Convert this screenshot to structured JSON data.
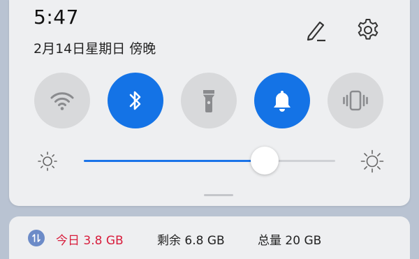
{
  "status": {
    "time": "5:47",
    "date": "2月14日星期日 傍晚"
  },
  "header_icons": [
    "edit-icon",
    "gear-icon"
  ],
  "toggles": [
    {
      "id": "wifi",
      "icon": "wifi-icon",
      "state": "off"
    },
    {
      "id": "bluetooth",
      "icon": "bluetooth-icon",
      "state": "on"
    },
    {
      "id": "flashlight",
      "icon": "flashlight-icon",
      "state": "off"
    },
    {
      "id": "sound",
      "icon": "bell-icon",
      "state": "on"
    },
    {
      "id": "vibrate",
      "icon": "vibrate-icon",
      "state": "off"
    }
  ],
  "brightness": {
    "level": 0.72
  },
  "data_usage": {
    "today": "今日 3.8 GB",
    "remaining": "剩余 6.8 GB",
    "total": "总量 20 GB"
  },
  "colors": {
    "accent": "#1473e6",
    "toggle_off": "#d8d9db",
    "today_text": "#d81d3c",
    "panel": "#eeeff1"
  }
}
